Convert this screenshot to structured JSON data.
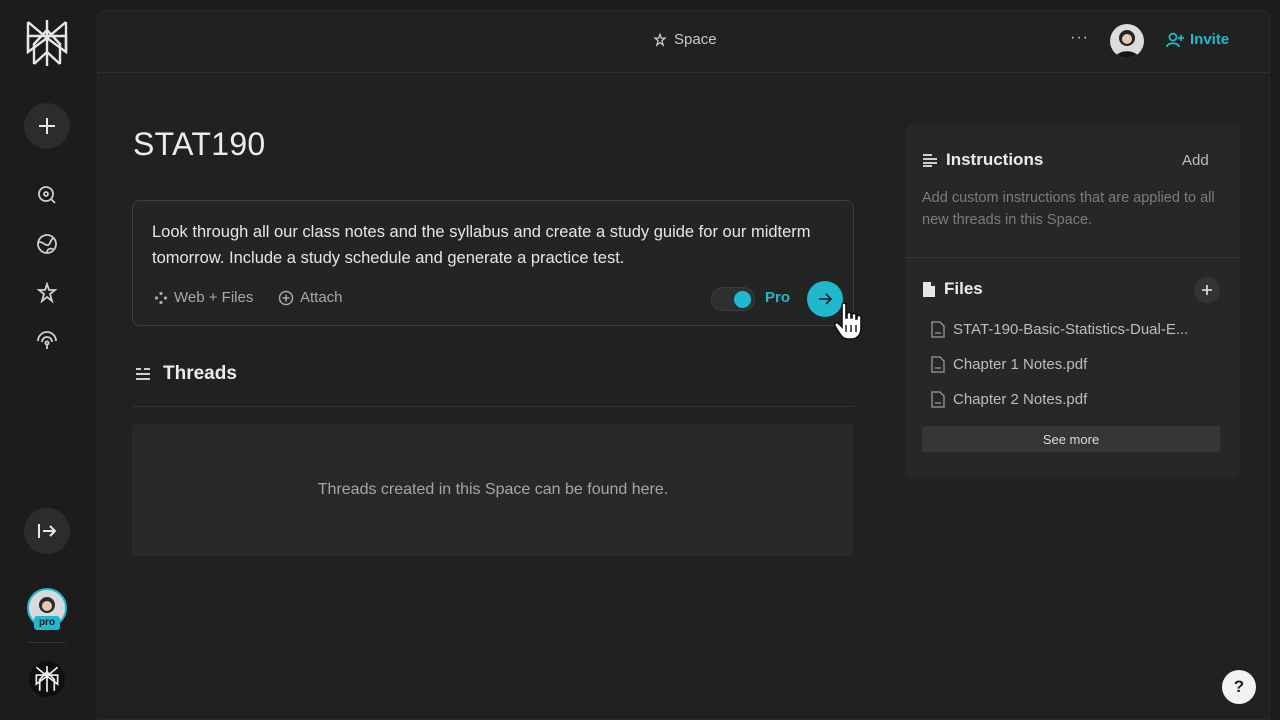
{
  "header": {
    "space_label": "Space",
    "more_label": "···",
    "invite_label": "Invite"
  },
  "page": {
    "title": "STAT190"
  },
  "composer": {
    "text": "Look through all our class notes and the syllabus and create a study guide for our midterm tomorrow. Include a study schedule and generate a practice test.",
    "source_label": "Web + Files",
    "attach_label": "Attach",
    "pro_label": "Pro",
    "pro_enabled": true
  },
  "threads": {
    "title": "Threads",
    "empty_text": "Threads created in this Space can be found here."
  },
  "instructions": {
    "title": "Instructions",
    "add_label": "Add",
    "placeholder": "Add custom instructions that are applied to all new threads in this Space."
  },
  "files": {
    "title": "Files",
    "items": [
      {
        "name": "STAT-190-Basic-Statistics-Dual-E..."
      },
      {
        "name": "Chapter 1 Notes.pdf"
      },
      {
        "name": "Chapter 2 Notes.pdf"
      }
    ],
    "see_more_label": "See more"
  },
  "sidebar": {
    "pro_badge": "pro",
    "icons": [
      "new-thread-icon",
      "search-icon",
      "globe-icon",
      "spaces-icon",
      "discover-icon",
      "collapse-icon"
    ]
  },
  "help_label": "?",
  "colors": {
    "accent": "#20b8cd",
    "background": "#1c1c1c",
    "panel": "#202121"
  }
}
